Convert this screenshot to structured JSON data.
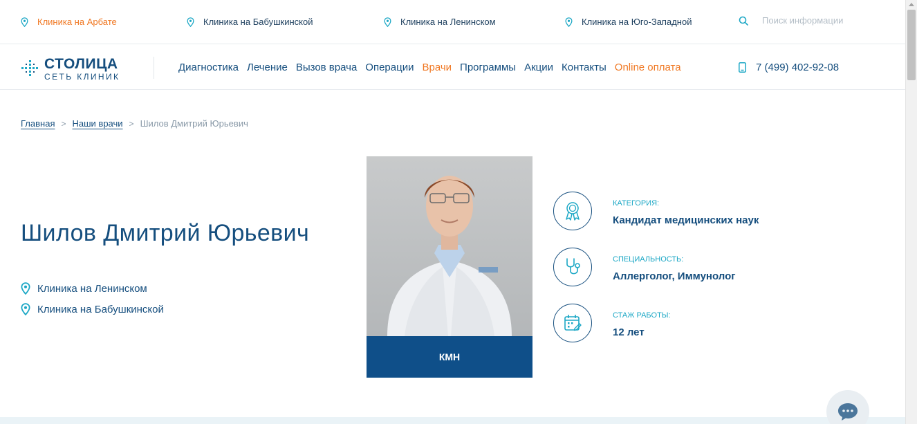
{
  "topbar": {
    "locations": [
      {
        "label": "Клиника на Арбате",
        "active": true
      },
      {
        "label": "Клиника на Бабушкинской",
        "active": false
      },
      {
        "label": "Клиника на Ленинском",
        "active": false
      },
      {
        "label": "Клиника на Юго-Западной",
        "active": false
      }
    ],
    "search": {
      "placeholder": "Поиск информации",
      "icon": "search-icon"
    }
  },
  "header": {
    "logo": {
      "title": "СТОЛИЦА",
      "subtitle": "СЕТЬ КЛИНИК"
    },
    "menu": [
      {
        "label": "Диагностика",
        "accent": false
      },
      {
        "label": "Лечение",
        "accent": false
      },
      {
        "label": "Вызов врача",
        "accent": false
      },
      {
        "label": "Операции",
        "accent": false
      },
      {
        "label": "Врачи",
        "accent": true
      },
      {
        "label": "Программы",
        "accent": false
      },
      {
        "label": "Акции",
        "accent": false
      },
      {
        "label": "Контакты",
        "accent": false
      },
      {
        "label": "Online оплата",
        "accent": true
      }
    ],
    "phone": "7 (499) 402-92-08"
  },
  "breadcrumb": {
    "home": "Главная",
    "doctors": "Наши врачи",
    "current": "Шилов Дмитрий Юрьевич"
  },
  "doctor": {
    "name": "Шилов Дмитрий Юрьевич",
    "clinics": [
      "Клиника на Ленинском",
      "Клиника на Бабушкинской"
    ],
    "photo_caption": "КМН",
    "info": [
      {
        "label": "КАТЕГОРИЯ:",
        "value": "Кандидат медицинских наук",
        "icon": "award-icon"
      },
      {
        "label": "СПЕЦИАЛЬНОСТЬ:",
        "value": "Аллерголог, Иммунолог",
        "icon": "stethoscope-icon"
      },
      {
        "label": "СТАЖ РАБОТЫ:",
        "value": "12 лет",
        "icon": "calendar-icon"
      }
    ]
  },
  "colors": {
    "primary": "#154e7e",
    "accent": "#f07823",
    "teal": "#1ba7c5",
    "caption_bg": "#0f4f89"
  }
}
